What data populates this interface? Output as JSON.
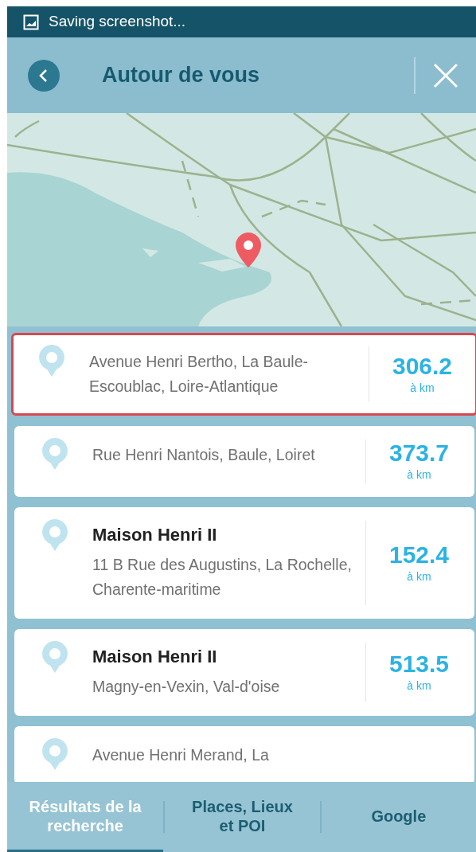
{
  "status_bar": {
    "notification": "Saving screenshot..."
  },
  "header": {
    "title": "Autour de vous"
  },
  "results": [
    {
      "address": "Avenue Henri Bertho, La Baule-Escoublac, Loire-Atlantique",
      "distance": "306.2",
      "unit": "à km",
      "selected": true
    },
    {
      "address": "Rue Henri Nantois, Baule, Loiret",
      "distance": "373.7",
      "unit": "à km",
      "selected": false
    },
    {
      "title": "Maison Henri II",
      "address": "11 B Rue des Augustins, La Rochelle, Charente-maritime",
      "distance": "152.4",
      "unit": "à km",
      "selected": false
    },
    {
      "title": "Maison Henri II",
      "address": "Magny-en-Vexin, Val-d'oise",
      "distance": "513.5",
      "unit": "à km",
      "selected": false
    },
    {
      "address": "Avenue Henri Merand, La",
      "selected": false
    }
  ],
  "tabs": [
    {
      "label": "Résultats de la recherche",
      "selected": true
    },
    {
      "label": "Places, Lieux et POI",
      "selected": false
    },
    {
      "label": "Google",
      "selected": false
    }
  ]
}
